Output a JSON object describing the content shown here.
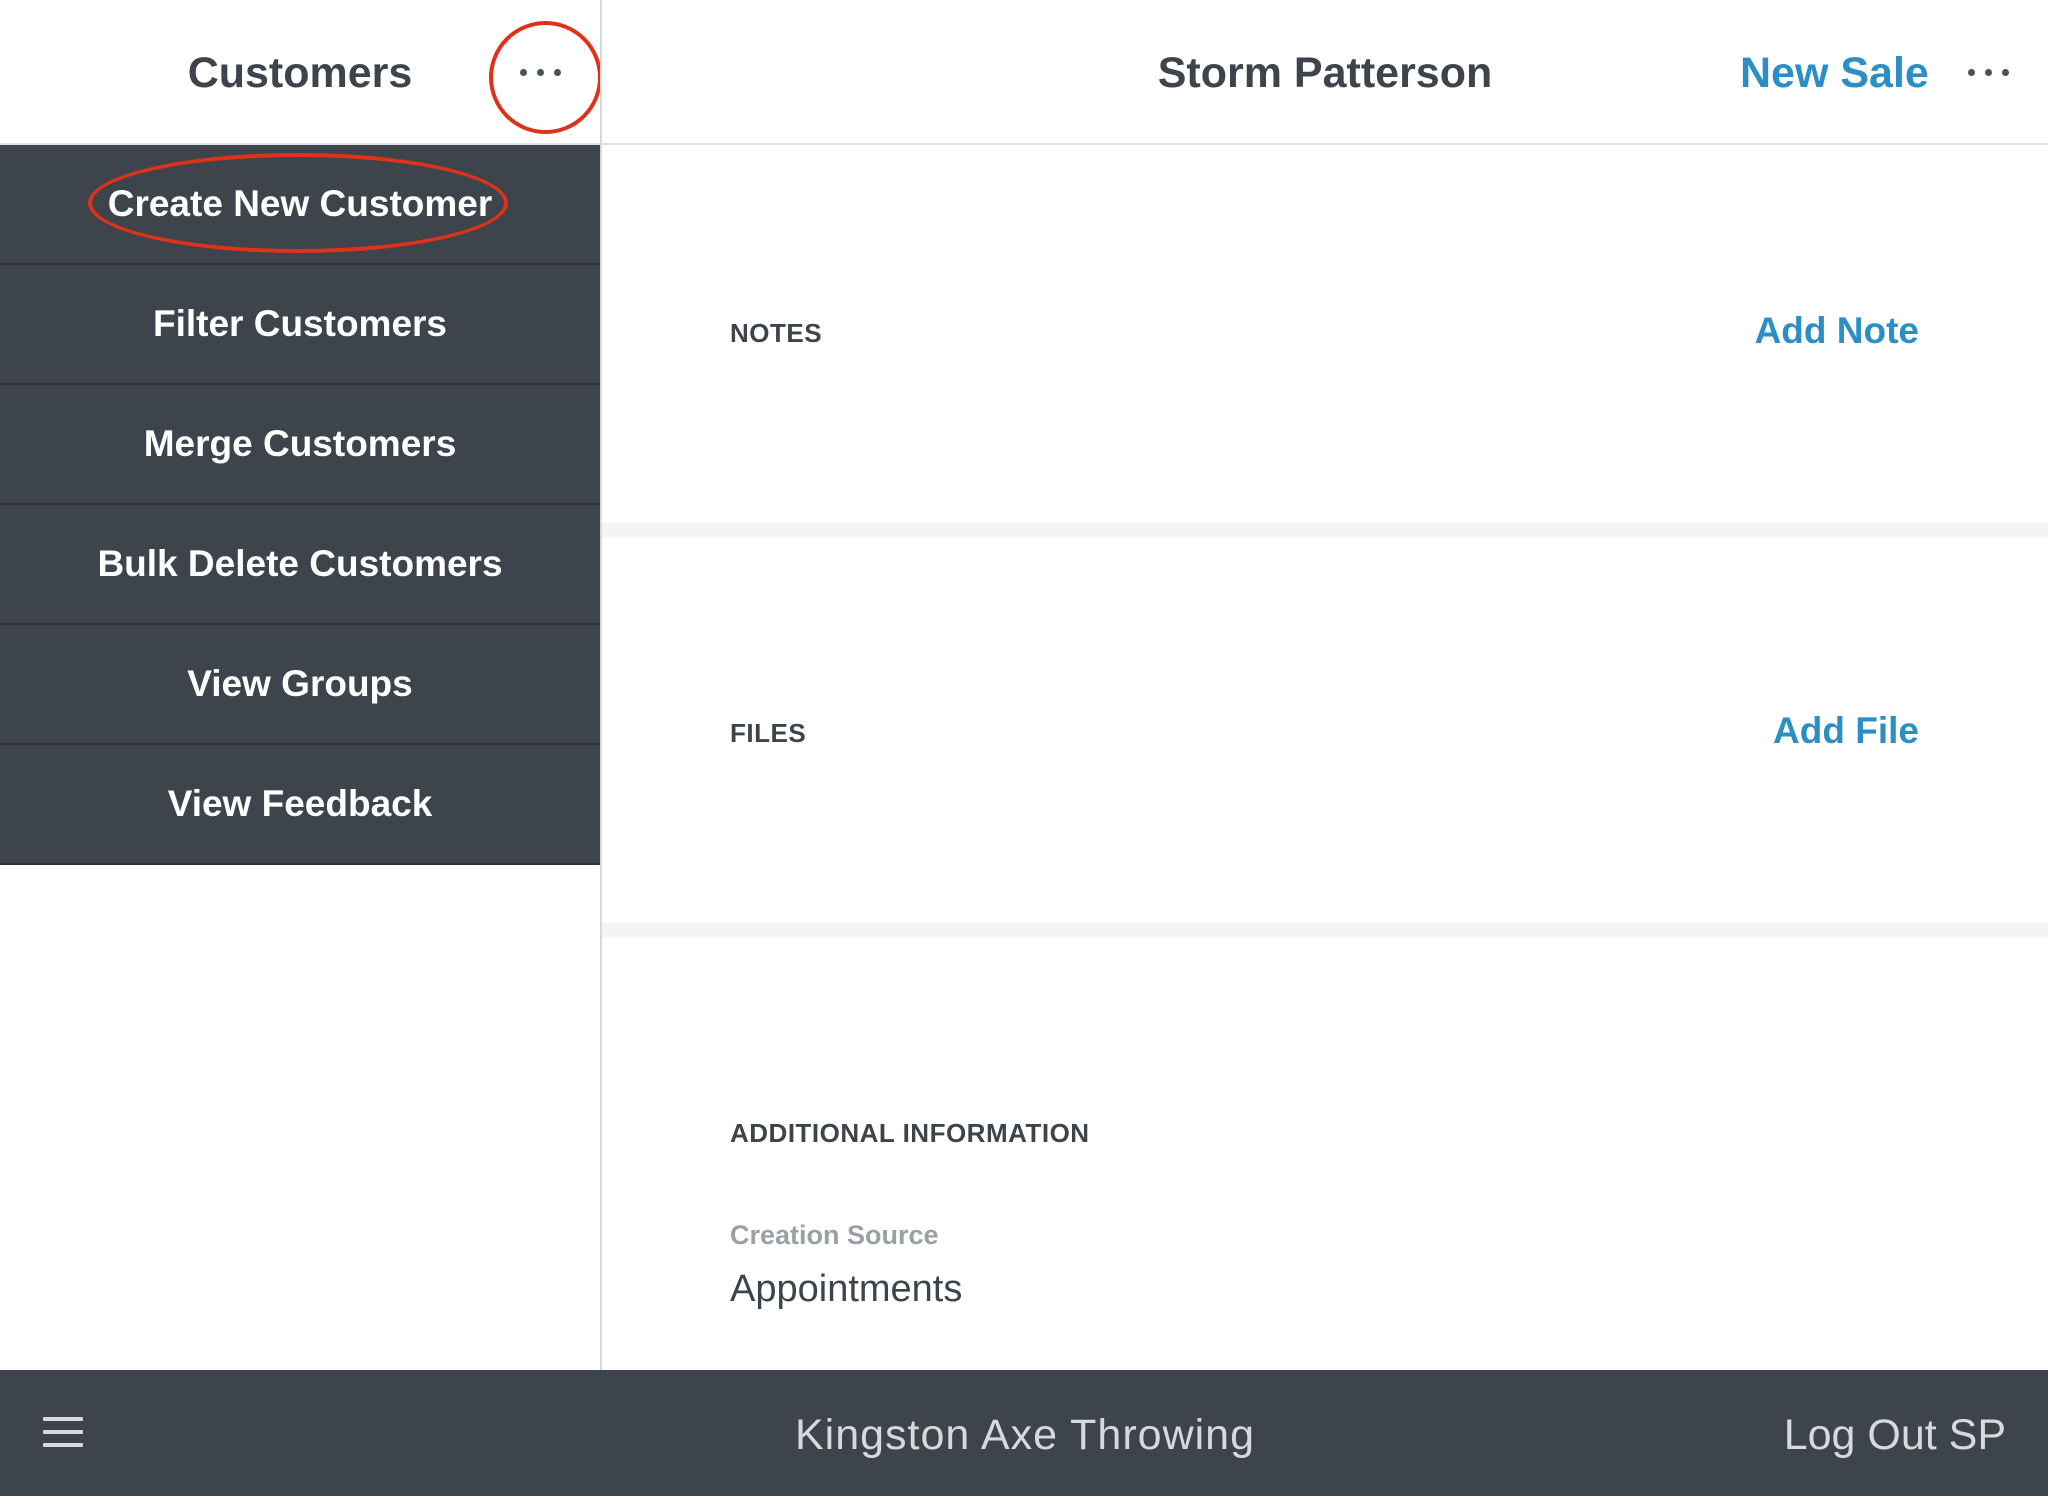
{
  "left_panel": {
    "title": "Customers",
    "more_icon": "ellipsis-icon",
    "menu": [
      {
        "label": "Create New Customer"
      },
      {
        "label": "Filter Customers"
      },
      {
        "label": "Merge Customers"
      },
      {
        "label": "Bulk Delete Customers"
      },
      {
        "label": "View Groups"
      },
      {
        "label": "View Feedback"
      }
    ]
  },
  "header": {
    "customer_name": "Storm Patterson",
    "new_sale_label": "New Sale",
    "more_icon": "ellipsis-icon"
  },
  "sections": {
    "notes": {
      "label": "NOTES",
      "action": "Add Note"
    },
    "files": {
      "label": "FILES",
      "action": "Add File"
    },
    "additional": {
      "label": "ADDITIONAL INFORMATION",
      "field_label": "Creation Source",
      "field_value": "Appointments"
    }
  },
  "footer": {
    "menu_icon": "hamburger-icon",
    "business_name": "Kingston Axe Throwing",
    "logout_label": "Log Out SP"
  },
  "colors": {
    "accent": "#2b8fc6",
    "dark_panel": "#3d444b",
    "annotation": "#e0321a"
  }
}
